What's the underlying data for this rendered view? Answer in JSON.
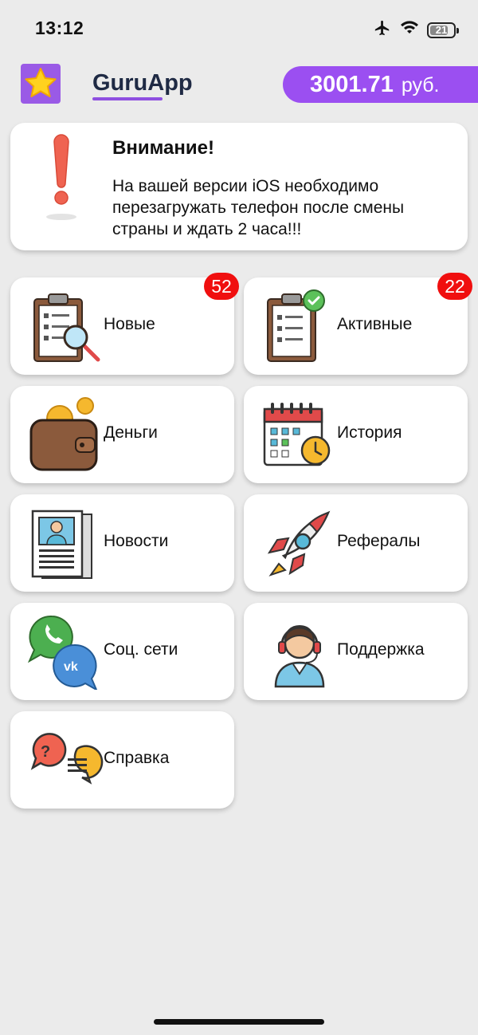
{
  "status_bar": {
    "time": "13:12",
    "battery": "21"
  },
  "header": {
    "app_name": "GuruApp",
    "balance_amount": "3001.71",
    "balance_currency": "руб."
  },
  "notice": {
    "title": "Внимание!",
    "text": "На вашей версии iOS необходимо перезагружать телефон после смены страны и ждать 2 часа!!!"
  },
  "tiles": [
    {
      "label": "Новые",
      "badge": "52",
      "icon": "clipboard-search-icon"
    },
    {
      "label": "Активные",
      "badge": "22",
      "icon": "clipboard-check-icon"
    },
    {
      "label": "Деньги",
      "icon": "wallet-icon"
    },
    {
      "label": "История",
      "icon": "calendar-clock-icon"
    },
    {
      "label": "Новости",
      "icon": "newspaper-icon"
    },
    {
      "label": "Рефералы",
      "icon": "rocket-icon"
    },
    {
      "label": "Соц. сети",
      "icon": "social-chat-icon"
    },
    {
      "label": "Поддержка",
      "icon": "support-agent-icon"
    },
    {
      "label": "Справка",
      "icon": "help-chat-icon"
    }
  ],
  "colors": {
    "accent": "#9b4ff1",
    "badge": "#f00f0f",
    "background": "#ebebeb"
  }
}
